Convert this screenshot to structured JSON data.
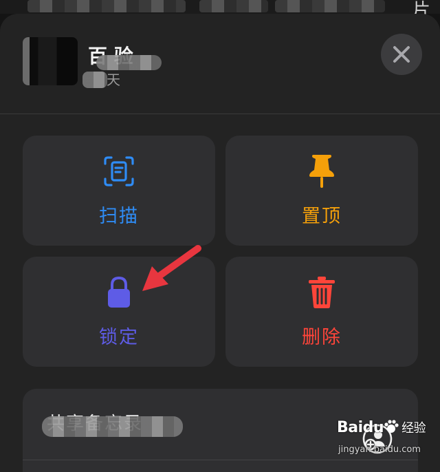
{
  "top_strip": {
    "edge_char": "片"
  },
  "header": {
    "title": "百 验",
    "subtitle": "天",
    "close_label": "✕"
  },
  "actions": [
    {
      "id": "scan",
      "label": "扫描",
      "icon": "scan-document-icon",
      "color": "#2f8cf5"
    },
    {
      "id": "pin",
      "label": "置顶",
      "icon": "pin-icon",
      "color": "#f5a00a"
    },
    {
      "id": "lock",
      "label": "锁定",
      "icon": "lock-icon",
      "color": "#5e5ce6"
    },
    {
      "id": "delete",
      "label": "删除",
      "icon": "trash-icon",
      "color": "#ff453a"
    }
  ],
  "annotation": {
    "arrow_color": "#e8363f"
  },
  "bottom": {
    "label": "共享备忘录",
    "icon": "add-person-icon"
  },
  "watermark": {
    "brand": "Baidu",
    "brand_cn": "经验",
    "url": "jingyan.baidu.com"
  }
}
